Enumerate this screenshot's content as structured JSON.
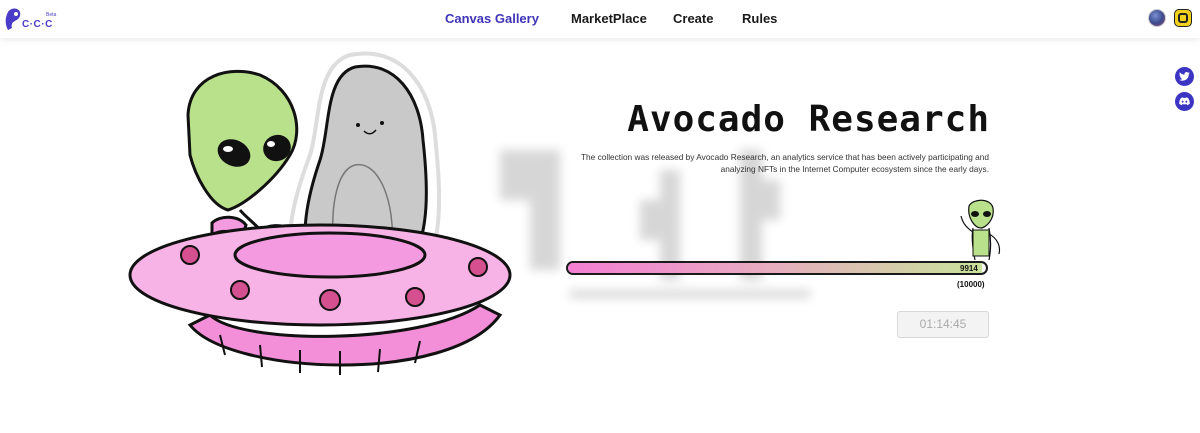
{
  "logo": {
    "text": "C·C·C",
    "beta": "Beta"
  },
  "nav": [
    {
      "label": "Canvas Gallery",
      "active": true
    },
    {
      "label": "MarketPlace",
      "active": false
    },
    {
      "label": "Create",
      "active": false
    },
    {
      "label": "Rules",
      "active": false
    }
  ],
  "header_icons": [
    "avatar",
    "wallet-icon"
  ],
  "social": [
    "twitter-icon",
    "discord-icon"
  ],
  "hero": {
    "title": "Avocado Research",
    "description": "The collection was released by Avocado Research, an analytics service that has been actively participating and analyzing NFTs in the Internet Computer ecosystem since the early days."
  },
  "progress": {
    "current": "9914",
    "total": "(10000)",
    "fraction": 0.9914
  },
  "timer": "01:14:45",
  "colors": {
    "accent": "#3f35b8",
    "progress_start": "#f47ed3",
    "progress_end": "#c8e29a",
    "ufo_pink": "#f49ae0",
    "alien_green": "#b9e08a"
  }
}
